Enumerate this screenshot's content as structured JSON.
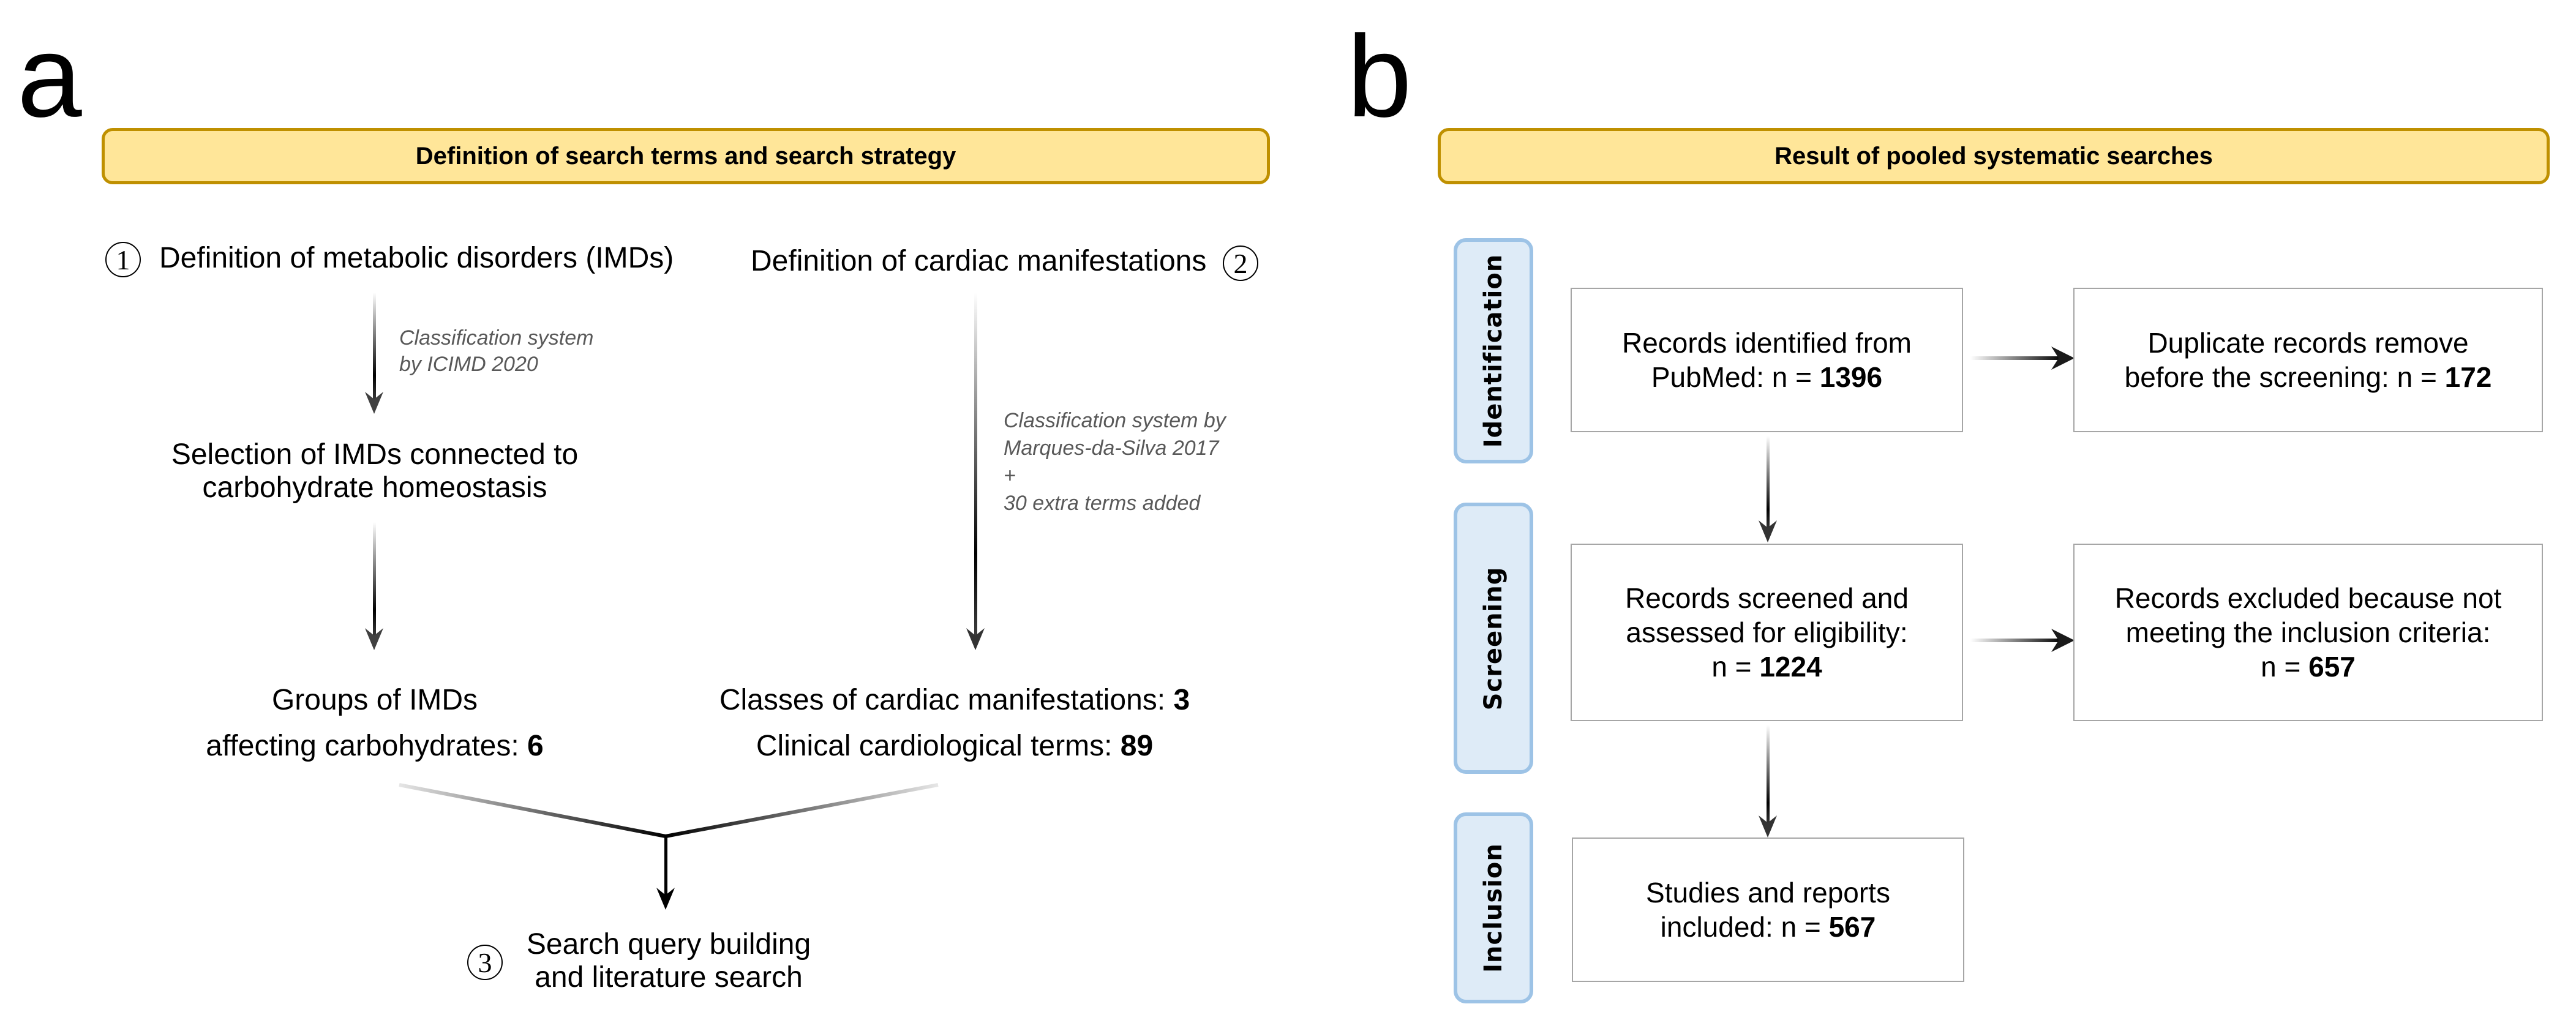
{
  "panel_a": {
    "letter": "a",
    "banner": "Definition of search terms and search strategy",
    "step1": {
      "number": "1",
      "label": "Definition of metabolic disorders (IMDs)"
    },
    "step2": {
      "number": "2",
      "label": "Definition of cardiac manifestations"
    },
    "note_left": [
      "Classification system",
      "by ICIMD  2020"
    ],
    "note_right": [
      "Classification system by",
      "Marques-da-Silva 2017",
      "+",
      "30 extra terms  added"
    ],
    "selection": [
      "Selection of IMDs connected to",
      "carbohydrate homeostasis"
    ],
    "groups": {
      "line1": "Groups of IMDs",
      "line2_prefix": "affecting carbohydrates: ",
      "count": "6"
    },
    "classes": {
      "line1_prefix": "Classes of cardiac manifestations: ",
      "classes_count": "3",
      "line2_prefix": "Clinical cardiological terms: ",
      "terms_count": "89"
    },
    "step3": {
      "number": "3",
      "label": [
        "Search query building",
        "and literature search"
      ]
    }
  },
  "panel_b": {
    "letter": "b",
    "banner": "Result of pooled systematic searches",
    "stages": [
      "Identification",
      "Screening",
      "Inclusion"
    ],
    "boxes": {
      "identified": {
        "line1": "Records identified from",
        "prefix": "PubMed: n = ",
        "n": "1396"
      },
      "duplicates": {
        "line1": "Duplicate records remove",
        "prefix": "before the screening: n = ",
        "n": "172"
      },
      "screened": {
        "line1": "Records screened and",
        "line2": "assessed for eligibility:",
        "prefix": "n = ",
        "n": "1224"
      },
      "excluded": {
        "line1": "Records excluded because not",
        "line2": "meeting the inclusion criteria:",
        "prefix": "n = ",
        "n": "657"
      },
      "included": {
        "line1": "Studies and reports",
        "prefix": "included: n = ",
        "n": "567"
      }
    }
  },
  "colors": {
    "banner_fill": "#ffe699",
    "banner_border": "#bf9000",
    "stage_fill": "#deebf7",
    "stage_border": "#9dc3e6",
    "box_border": "#a6a6a6",
    "note_text": "#595959"
  }
}
